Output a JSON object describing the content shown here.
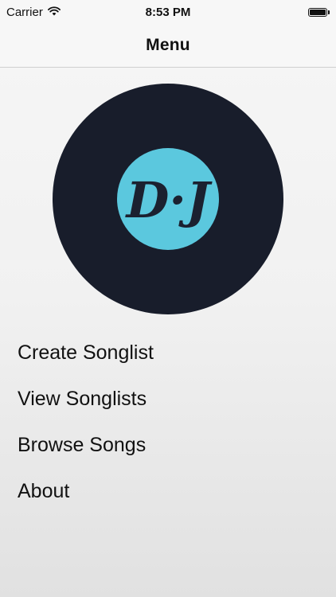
{
  "status_bar": {
    "carrier": "Carrier",
    "time": "8:53 PM",
    "battery_level": 1.0
  },
  "nav": {
    "title": "Menu"
  },
  "logo": {
    "text": "D·J",
    "icon": "vinyl-record-icon",
    "colors": {
      "record": "#181d2b",
      "label": "#5bc8de",
      "lettering": "#1b2130"
    }
  },
  "menu": {
    "items": [
      {
        "label": "Create Songlist"
      },
      {
        "label": "View Songlists"
      },
      {
        "label": "Browse Songs"
      },
      {
        "label": "About"
      }
    ]
  }
}
